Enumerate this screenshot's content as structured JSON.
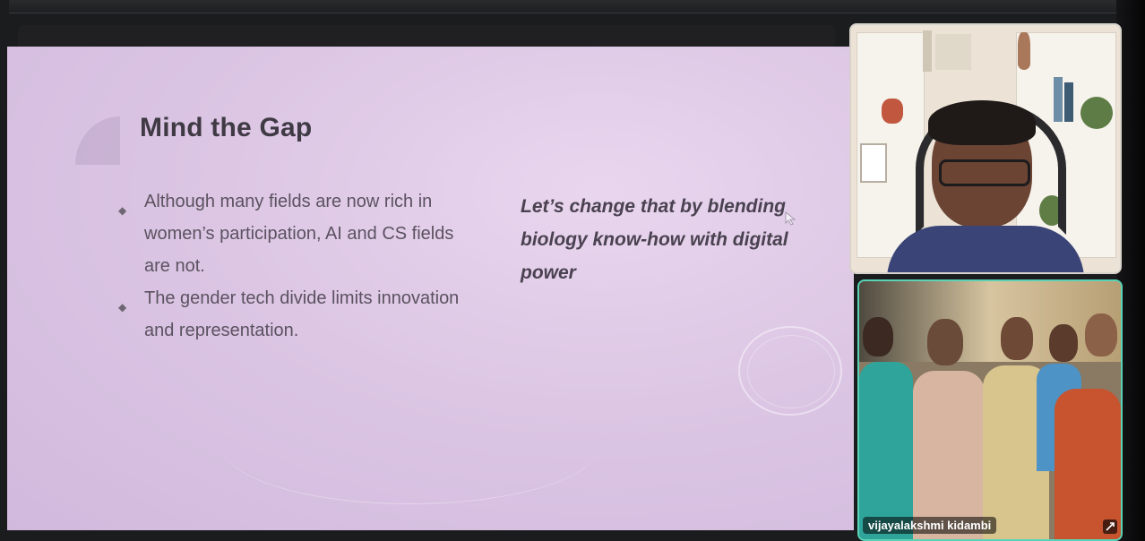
{
  "slide": {
    "title": "Mind the Gap",
    "bullets": [
      "Although many fields are now rich in women’s participation,  AI and CS fields are not.",
      "The gender tech divide limits innovation and representation."
    ],
    "quote": "Let’s change that by blending biology know-how with digital power"
  },
  "participants": [
    {
      "tile": "speaker-video",
      "name": ""
    },
    {
      "tile": "room-video",
      "name": "vijayalakshmi kidambi"
    }
  ],
  "colors": {
    "slide_background": "#dcc6e4",
    "active_speaker_border": "#59d2b6",
    "title_text": "#3f3a44"
  },
  "icons": [
    "bullet-diamond-icon",
    "mouse-pointer-icon",
    "pin-icon"
  ]
}
